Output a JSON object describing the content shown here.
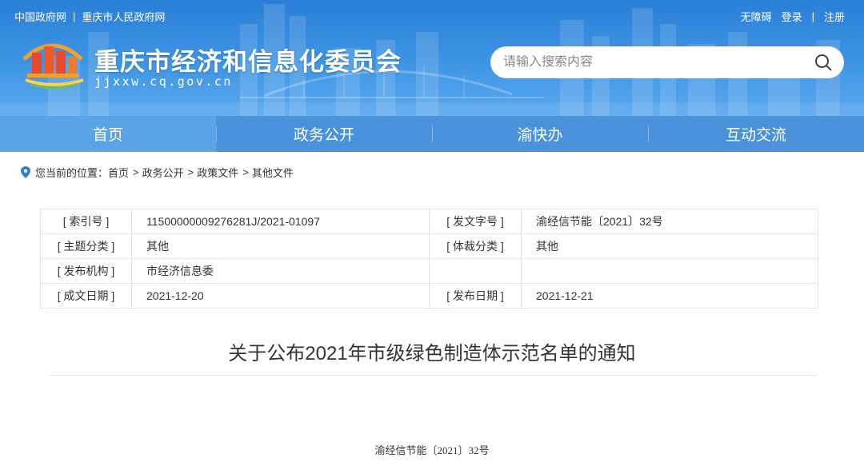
{
  "header": {
    "top_links": [
      "中国政府网",
      "重庆市人民政府网"
    ],
    "top_separator": "|",
    "user_links": [
      "无障碍",
      "登录",
      "注册"
    ],
    "site_title": "重庆市经济和信息化委员会",
    "site_domain": "jjxxw.cq.gov.cn",
    "search": {
      "placeholder": "请输入搜索内容",
      "icon": "search-icon"
    },
    "colors": {
      "banner": "#2a7fd6",
      "nav": "#4a93dc",
      "nav_active": "#5aa3e6"
    }
  },
  "nav": {
    "items": [
      "首页",
      "政务公开",
      "渝快办",
      "互动交流"
    ]
  },
  "breadcrumb": {
    "prefix": "您当前的位置：",
    "items": [
      "首页",
      "政务公开",
      "政策文件",
      "其他文件"
    ],
    "separator": ">"
  },
  "info_table": {
    "rows": [
      {
        "l1": "[ 索引号 ]",
        "v1": "11500000009276281J/2021-01097",
        "l2": "[ 发文字号 ]",
        "v2": "渝经信节能〔2021〕32号"
      },
      {
        "l1": "[ 主题分类 ]",
        "v1": "其他",
        "l2": "[ 体裁分类 ]",
        "v2": "其他"
      },
      {
        "l1": "[ 发布机构 ]",
        "v1": "市经济信息委",
        "l2": "",
        "v2": ""
      },
      {
        "l1": "[ 成文日期 ]",
        "v1": "2021-12-20",
        "l2": "[ 发布日期 ]",
        "v2": "2021-12-21"
      }
    ]
  },
  "article": {
    "title": "关于公布2021年市级绿色制造体示范名单的通知",
    "doc_number": "渝经信节能〔2021〕32号"
  }
}
